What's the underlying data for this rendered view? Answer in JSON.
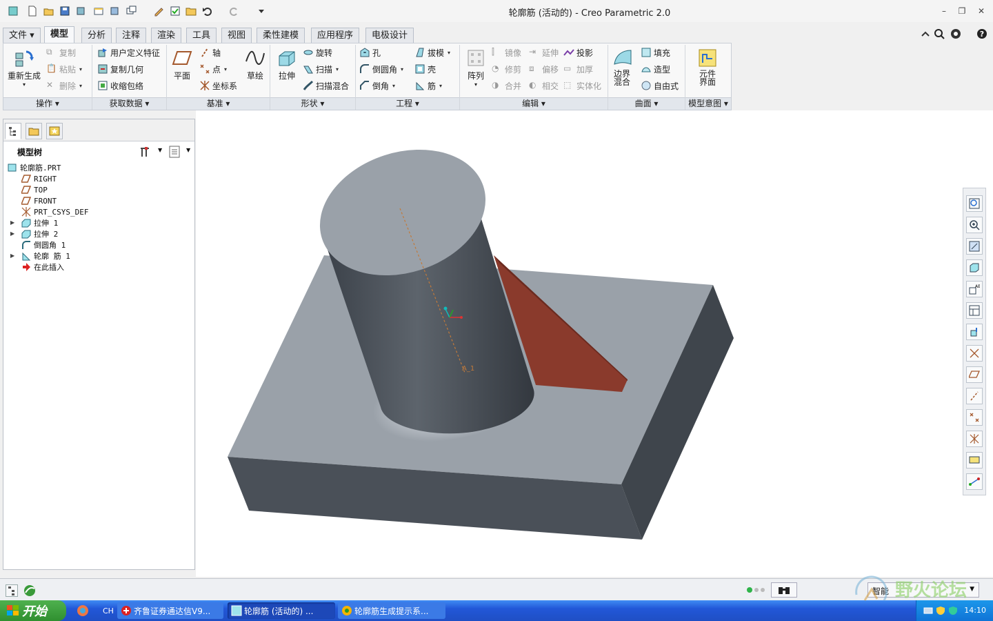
{
  "window": {
    "title": "轮廓筋 (活动的) - Creo Parametric 2.0"
  },
  "tabs": [
    "文件",
    "模型",
    "分析",
    "注释",
    "渲染",
    "工具",
    "视图",
    "柔性建模",
    "应用程序",
    "电极设计"
  ],
  "ribbon": {
    "operations": {
      "label": "操作",
      "regenerate": "重新生成",
      "copy": "复制",
      "paste": "粘贴",
      "delete": "删除"
    },
    "get_data": {
      "label": "获取数据",
      "udf": "用户定义特征",
      "copy_geom": "复制几何",
      "shrinkwrap": "收缩包络"
    },
    "datum": {
      "label": "基准",
      "plane": "平面",
      "axis": "轴",
      "point": "点",
      "csys": "坐标系",
      "sketch": "草绘"
    },
    "shapes": {
      "label": "形状",
      "extrude": "拉伸",
      "revolve": "旋转",
      "sweep": "扫描",
      "swept_blend": "扫描混合"
    },
    "engineering": {
      "label": "工程",
      "hole": "孔",
      "draft": "拔模",
      "round": "倒圆角",
      "shell": "壳",
      "chamfer": "倒角",
      "rib": "筋"
    },
    "editing": {
      "label": "编辑",
      "pattern": "阵列",
      "mirror": "镜像",
      "extend": "延伸",
      "project": "投影",
      "trim": "修剪",
      "offset": "偏移",
      "thicken": "加厚",
      "merge": "合并",
      "intersect": "相交",
      "solidify": "实体化"
    },
    "surfaces": {
      "label": "曲面",
      "boundary_blend": "边界\n混合",
      "fill": "填充",
      "style": "造型",
      "freestyle": "自由式"
    },
    "design_intent": {
      "label": "模型意图",
      "component_interface": "元件\n界面"
    }
  },
  "model_tree": {
    "title": "模型树",
    "items": [
      {
        "label": "轮廓筋.PRT",
        "icon": "part-icon"
      },
      {
        "label": "RIGHT",
        "icon": "datum-plane-icon"
      },
      {
        "label": "TOP",
        "icon": "datum-plane-icon"
      },
      {
        "label": "FRONT",
        "icon": "datum-plane-icon"
      },
      {
        "label": "PRT_CSYS_DEF",
        "icon": "csys-icon"
      },
      {
        "label": "拉伸 1",
        "icon": "extrude-icon"
      },
      {
        "label": "拉伸 2",
        "icon": "extrude-icon"
      },
      {
        "label": "倒圆角 1",
        "icon": "round-icon"
      },
      {
        "label": "轮廓 筋 1",
        "icon": "rib-icon"
      },
      {
        "label": "在此插入",
        "icon": "insert-here-icon"
      }
    ]
  },
  "viewport": {
    "axis_label": "A_1"
  },
  "status": {
    "mode": "智能"
  },
  "taskbar": {
    "start": "开始",
    "lang": "CH",
    "tasks": [
      "齐鲁证券通达信V9...",
      "轮廓筋 (活动的) ...",
      "轮廓筋生成提示系..."
    ],
    "clock": "14:10"
  },
  "watermark": {
    "text": "野火论坛"
  },
  "colors": {
    "body_gray": "#4a5058",
    "top_gray": "#9aa1a9",
    "rib_red": "#8a3a2c",
    "taskbar_blue": "#2257d8"
  }
}
